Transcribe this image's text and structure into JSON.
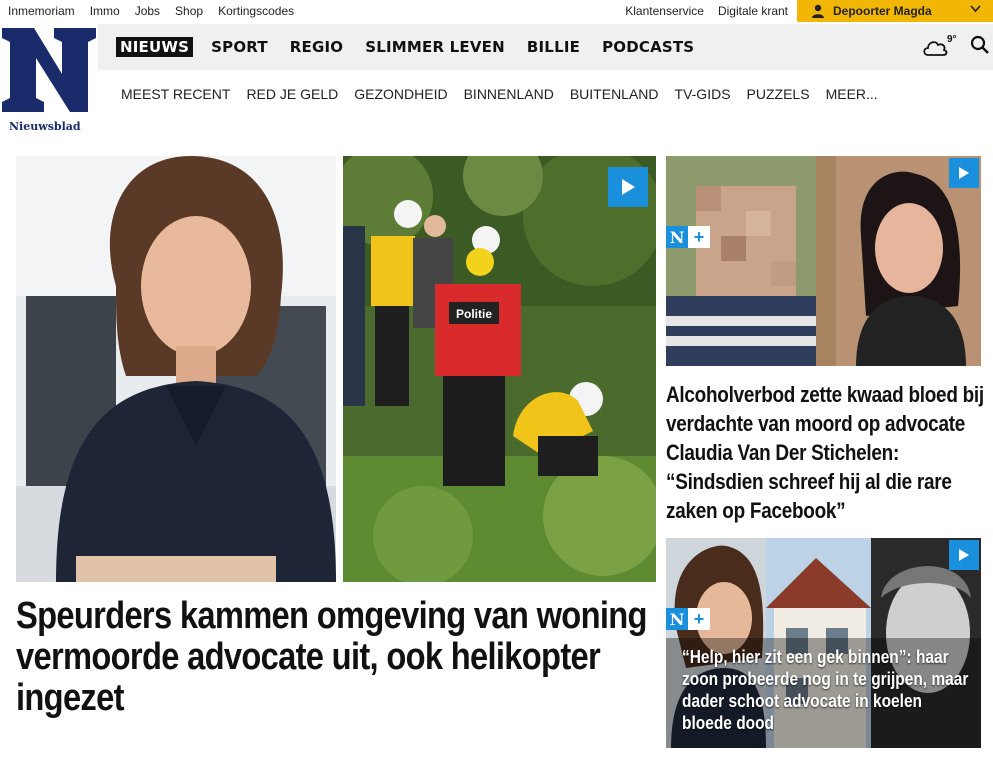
{
  "utility": {
    "left_links": [
      "Inmemoriam",
      "Immo",
      "Jobs",
      "Shop",
      "Kortingscodes"
    ],
    "right_links": [
      "Klantenservice",
      "Digitale krant"
    ],
    "user_name": "Depoorter Magda"
  },
  "logo": {
    "letter": "N",
    "brand": "Nieuwsblad"
  },
  "main_nav": [
    "NIEUWS",
    "SPORT",
    "REGIO",
    "SLIMMER LEVEN",
    "BILLIE",
    "PODCASTS"
  ],
  "weather": {
    "temperature": "9°",
    "icon": "cloud-icon"
  },
  "sub_nav": [
    "MEEST RECENT",
    "RED JE GELD",
    "GEZONDHEID",
    "BINNENLAND",
    "BUITENLAND",
    "TV-GIDS",
    "PUZZELS",
    "MEER..."
  ],
  "articles": {
    "main": {
      "headline": "Speurders kammen omgeving van woning vermoorde advocate uit, ook helikopter ingezet",
      "vest_label": "Politie"
    },
    "side_top": {
      "badge": "N+",
      "headline": "Alcoholverbod zette kwaad bloed bij verdachte van moord op advocate Claudia Van Der Stichelen: “Sindsdien schreef hij al die rare zaken op Facebook”"
    },
    "side_bottom": {
      "badge": "N+",
      "headline": "“Help, hier zit een gek binnen”: haar zoon probeerde nog in te grijpen, maar dader schoot advocate in koelen bloede dood"
    }
  },
  "colors": {
    "brand_navy": "#1a2b6b",
    "accent_blue": "#1a8fdc",
    "user_yellow": "#f2b705"
  }
}
